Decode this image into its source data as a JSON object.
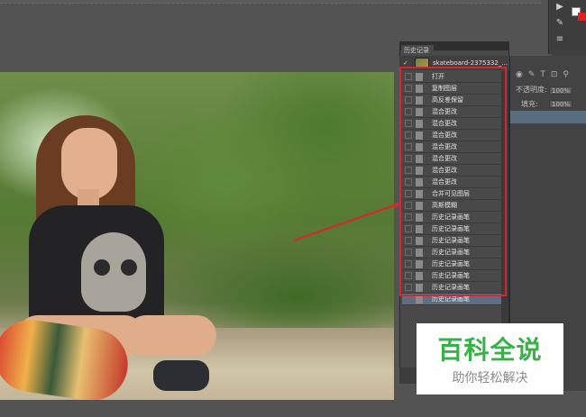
{
  "history_panel": {
    "tab_label": "历史记录",
    "snapshot_label": "skateboard-2375332_...",
    "items": [
      {
        "label": "打开"
      },
      {
        "label": "复制图层"
      },
      {
        "label": "高反差保留"
      },
      {
        "label": "混合更改"
      },
      {
        "label": "混合更改"
      },
      {
        "label": "混合更改"
      },
      {
        "label": "混合更改"
      },
      {
        "label": "混合更改"
      },
      {
        "label": "混合更改"
      },
      {
        "label": "混合更改"
      },
      {
        "label": "合并可见图层"
      },
      {
        "label": "高斯模糊"
      },
      {
        "label": "历史记录画笔"
      },
      {
        "label": "历史记录画笔"
      },
      {
        "label": "历史记录画笔"
      },
      {
        "label": "历史记录画笔"
      },
      {
        "label": "历史记录画笔"
      },
      {
        "label": "历史记录画笔"
      },
      {
        "label": "历史记录画笔"
      },
      {
        "label": "历史记录画笔"
      }
    ]
  },
  "layers_panel": {
    "opacity_label": "不透明度:",
    "opacity_value": "100%",
    "fill_label": "填充:",
    "fill_value": "100%"
  },
  "watermark": {
    "title": "百科全说",
    "subtitle": "助你轻松解决"
  },
  "colors": {
    "annotation": "#d8262c",
    "selection": "#5d6f82",
    "watermark_green": "#38b14a"
  }
}
